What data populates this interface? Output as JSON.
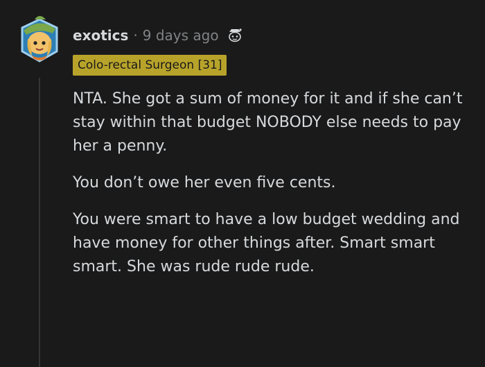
{
  "comment": {
    "username": "exotics",
    "separator": "·",
    "timestamp": "9 days ago",
    "flair": "Colo-rectal Surgeon [31]",
    "paragraphs": [
      "NTA. She got a sum of money for it and if she can’t stay within that budget NOBODY else needs to pay her a penny.",
      "You don’t owe her even five cents.",
      "You were smart to have a low budget wedding and have money for other things after. Smart smart smart. She was rude rude rude."
    ]
  },
  "icons": {
    "avatar": "user-avatar-snoo-hat",
    "award": "snoo-award-icon"
  },
  "colors": {
    "background": "#1a1a1b",
    "text": "#d7dadc",
    "muted": "#818384",
    "flair_bg": "#b8a32a"
  }
}
